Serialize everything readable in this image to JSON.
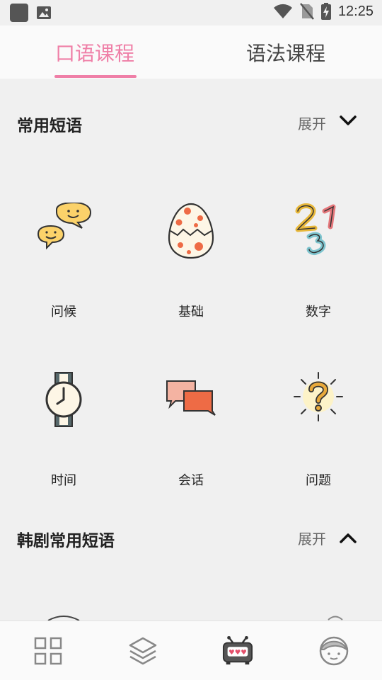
{
  "status_bar": {
    "time": "12:25"
  },
  "tabs": [
    {
      "label": "口语课程",
      "active": true
    },
    {
      "label": "语法课程",
      "active": false
    }
  ],
  "sections": [
    {
      "title": "常用短语",
      "expand_label": "展开",
      "items": [
        {
          "label": "问候",
          "icon": "speech-bubbles-smiley-icon"
        },
        {
          "label": "基础",
          "icon": "cracked-egg-icon"
        },
        {
          "label": "数字",
          "icon": "numbers-icon"
        },
        {
          "label": "时间",
          "icon": "wristwatch-icon"
        },
        {
          "label": "会话",
          "icon": "conversation-bubbles-icon"
        },
        {
          "label": "问题",
          "icon": "question-mark-icon"
        }
      ]
    },
    {
      "title": "韩剧常用短语",
      "expand_label": "展开"
    }
  ],
  "bottom_nav": [
    {
      "icon": "grid-icon"
    },
    {
      "icon": "layers-icon"
    },
    {
      "icon": "tv-icon",
      "active": true
    },
    {
      "icon": "profile-face-icon"
    }
  ],
  "colors": {
    "accent": "#ef7fa7",
    "background": "#f0f0f0"
  }
}
